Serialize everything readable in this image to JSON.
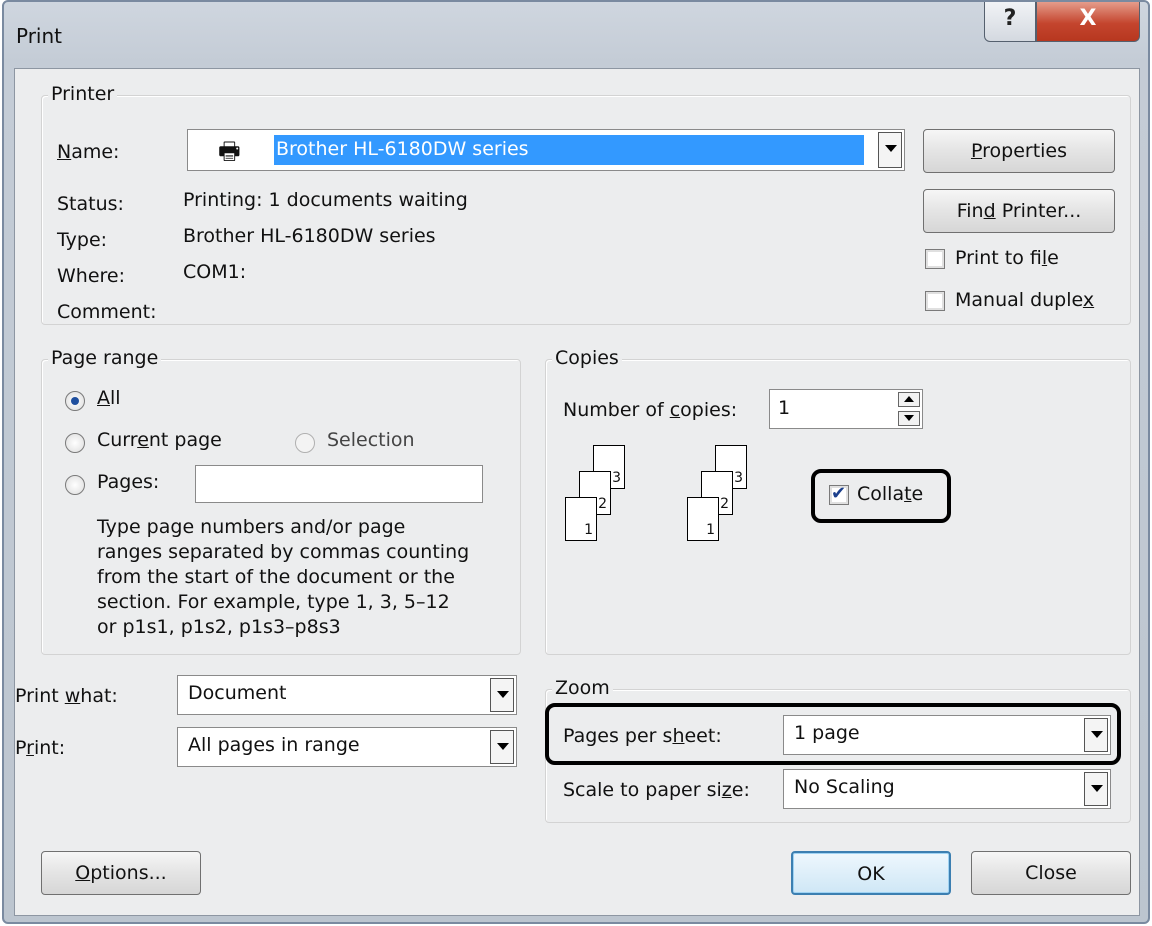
{
  "window": {
    "title": "Print",
    "help_glyph": "?",
    "close_glyph": "X"
  },
  "printer": {
    "legend": "Printer",
    "name_label": "Name:",
    "name_value": "Brother HL-6180DW series",
    "status_label": "Status:",
    "status_value": "Printing: 1 documents waiting",
    "type_label": "Type:",
    "type_value": "Brother HL-6180DW series",
    "where_label": "Where:",
    "where_value": "COM1:",
    "comment_label": "Comment:",
    "properties_button": "Properties",
    "find_printer_button": "Find Printer...",
    "print_to_file_label": "Print to file",
    "print_to_file_checked": false,
    "manual_duplex_label": "Manual duplex",
    "manual_duplex_checked": false
  },
  "page_range": {
    "legend": "Page range",
    "all_label": "All",
    "current_page_label": "Current page",
    "selection_label": "Selection",
    "pages_label": "Pages:",
    "pages_value": "",
    "selected_option": "All",
    "help_lines": [
      "Type page numbers and/or page",
      "ranges separated by commas counting",
      "from the start of the document or the",
      "section. For example, type 1, 3, 5–12",
      "or p1s1, p1s2, p1s3–p8s3"
    ]
  },
  "copies": {
    "legend": "Copies",
    "number_label": "Number of copies:",
    "number_value": "1",
    "collate_label": "Collate",
    "collate_checked": true,
    "stack_page_numbers": [
      "3",
      "2",
      "1"
    ]
  },
  "print_what": {
    "label": "Print what:",
    "value": "Document",
    "print_label": "Print:",
    "print_value": "All pages in range"
  },
  "zoom": {
    "legend": "Zoom",
    "pages_per_sheet_label": "Pages per sheet:",
    "pages_per_sheet_value": "1 page",
    "scale_label": "Scale to paper size:",
    "scale_value": "No Scaling"
  },
  "footer": {
    "options_button": "Options...",
    "ok_button": "OK",
    "close_button": "Close"
  },
  "colors": {
    "selection": "#3399ff",
    "default_button_border": "#3c7fb1",
    "close_red": "#c4452e"
  }
}
